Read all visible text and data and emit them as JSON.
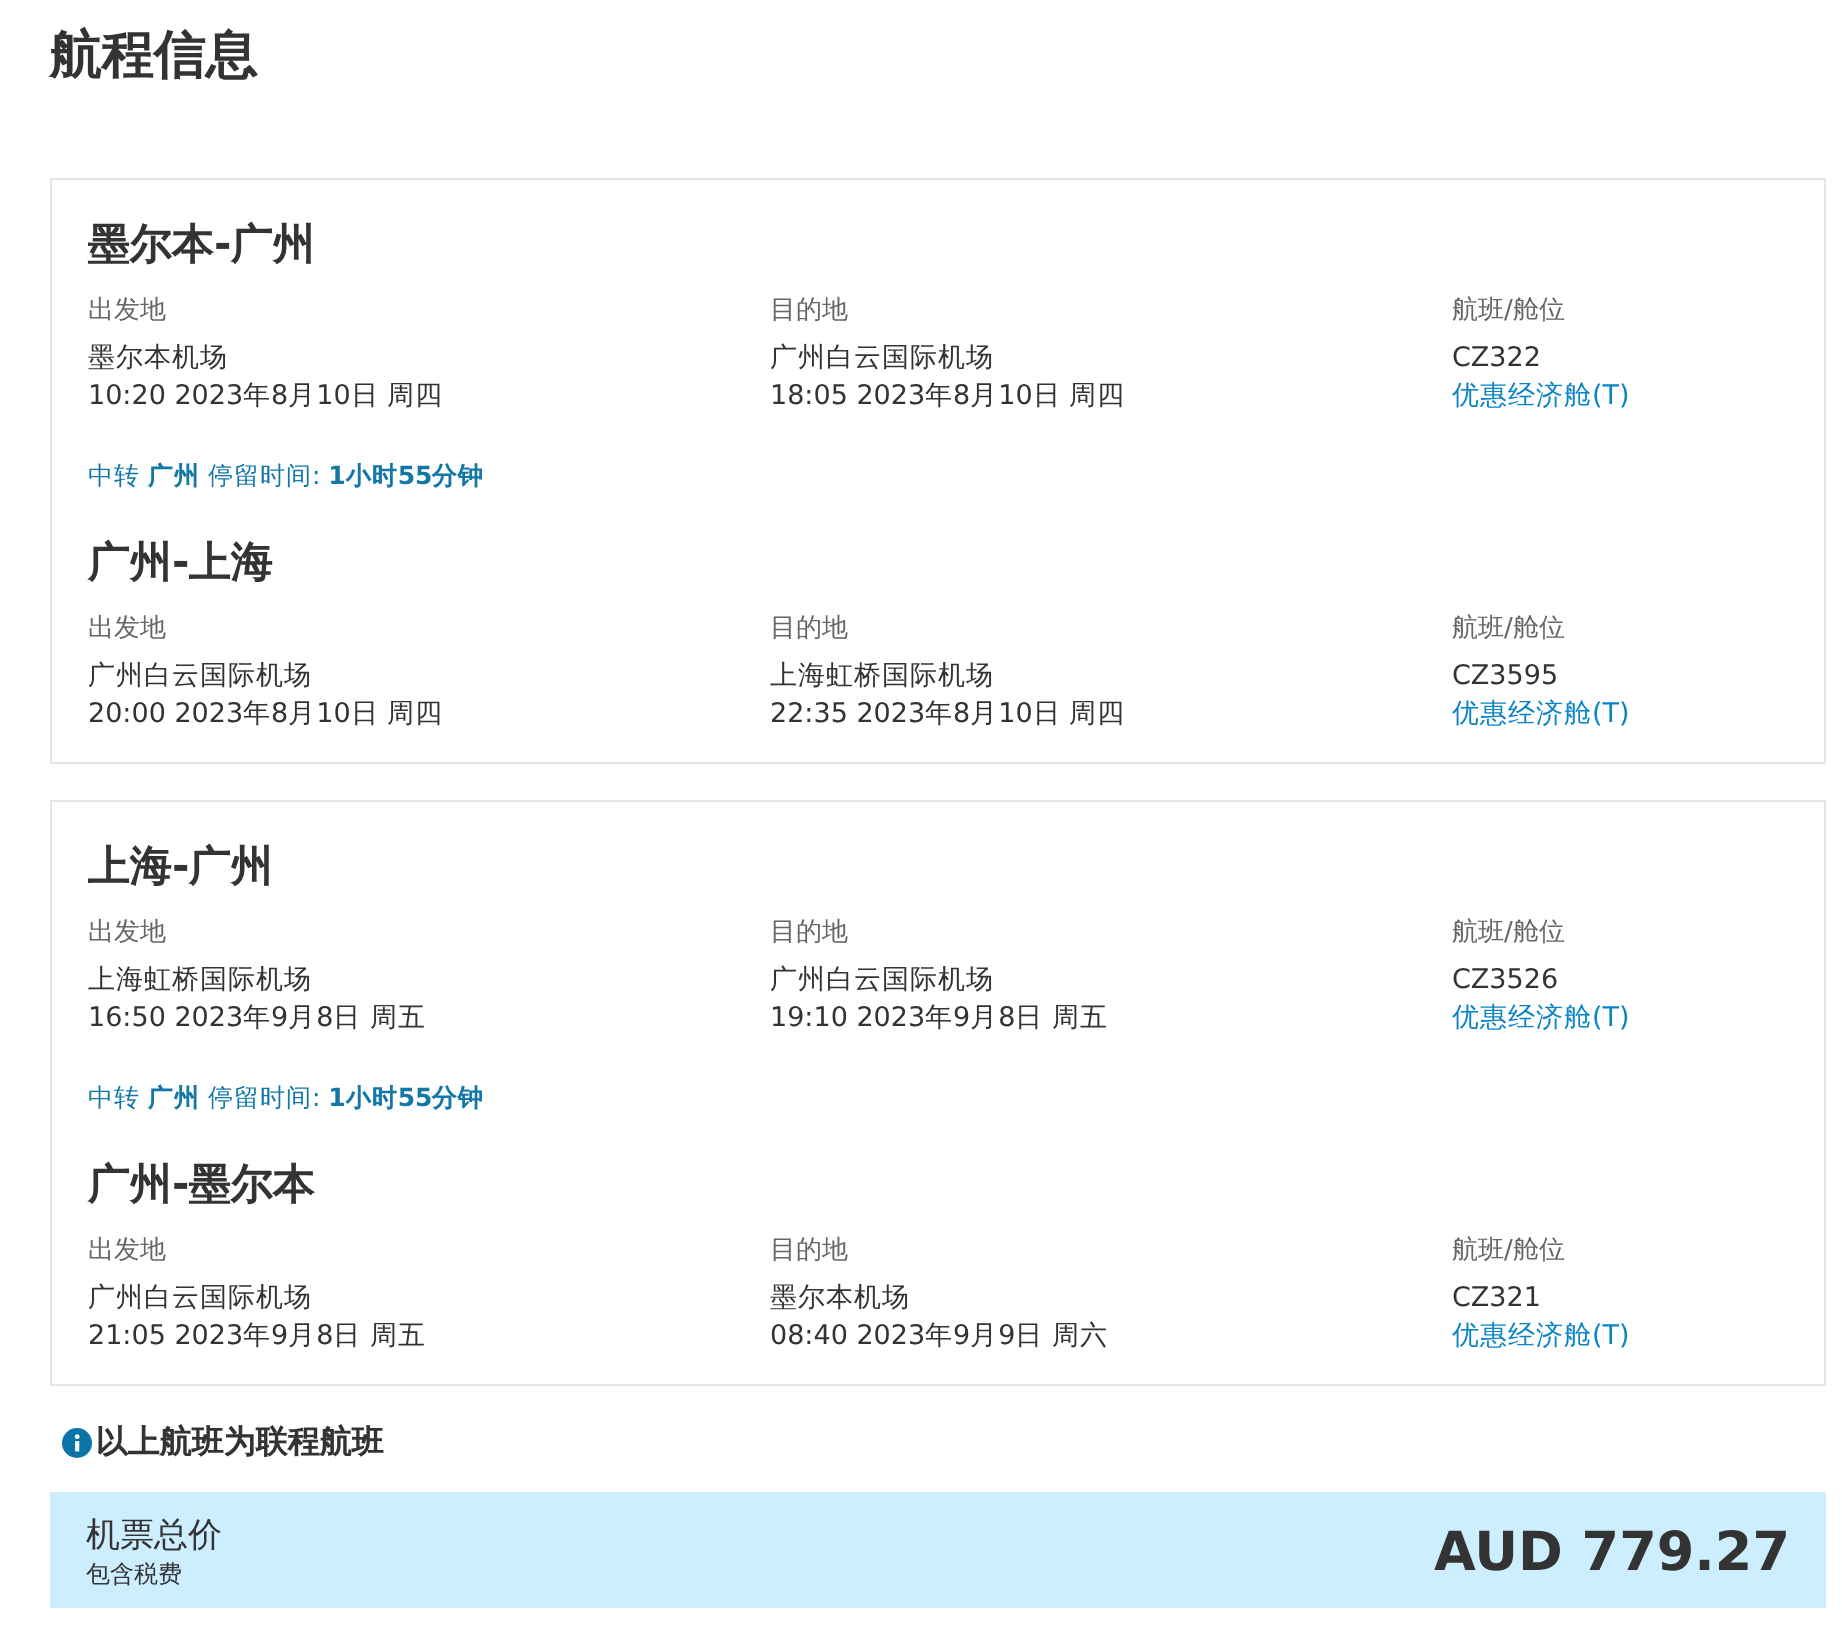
{
  "title": "航程信息",
  "trips": [
    {
      "segments": [
        {
          "route": "墨尔本-广州",
          "departure": {
            "label": "出发地",
            "airport": "墨尔本机场",
            "time": "10:20 2023年8月10日 周四"
          },
          "arrival": {
            "label": "目的地",
            "airport": "广州白云国际机场",
            "time": "18:05 2023年8月10日 周四"
          },
          "flight": {
            "label": "航班/舱位",
            "number": "CZ322",
            "cabin": "优惠经济舱(T)"
          }
        },
        {
          "route": "广州-上海",
          "departure": {
            "label": "出发地",
            "airport": "广州白云国际机场",
            "time": "20:00 2023年8月10日 周四"
          },
          "arrival": {
            "label": "目的地",
            "airport": "上海虹桥国际机场",
            "time": "22:35 2023年8月10日 周四"
          },
          "flight": {
            "label": "航班/舱位",
            "number": "CZ3595",
            "cabin": "优惠经济舱(T)"
          }
        }
      ],
      "transfer": "中转 **广州** 停留时间: **1小时55分钟**"
    },
    {
      "segments": [
        {
          "route": "上海-广州",
          "departure": {
            "label": "出发地",
            "airport": "上海虹桥国际机场",
            "time": "16:50 2023年9月8日 周五"
          },
          "arrival": {
            "label": "目的地",
            "airport": "广州白云国际机场",
            "time": "19:10 2023年9月8日 周五"
          },
          "flight": {
            "label": "航班/舱位",
            "number": "CZ3526",
            "cabin": "优惠经济舱(T)"
          }
        },
        {
          "route": "广州-墨尔本",
          "departure": {
            "label": "出发地",
            "airport": "广州白云国际机场",
            "time": "21:05 2023年9月8日 周五"
          },
          "arrival": {
            "label": "目的地",
            "airport": "墨尔本机场",
            "time": "08:40 2023年9月9日 周六"
          },
          "flight": {
            "label": "航班/舱位",
            "number": "CZ321",
            "cabin": "优惠经济舱(T)"
          }
        }
      ],
      "transfer": "中转 **广州** 停留时间: **1小时55分钟**"
    }
  ],
  "note": "以上航班为联程航班",
  "total": {
    "label": "机票总价",
    "sublabel": "包含税费",
    "amount": "AUD 779.27"
  }
}
